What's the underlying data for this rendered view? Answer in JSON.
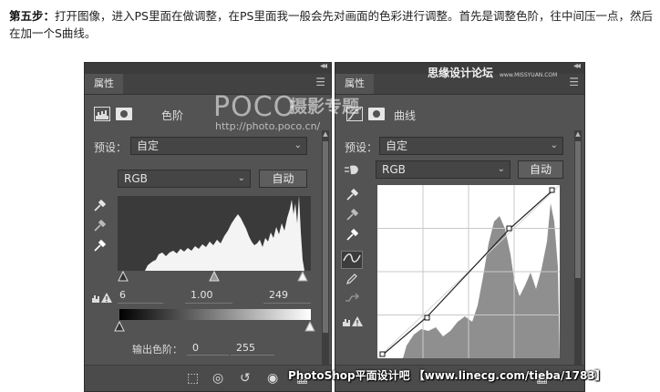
{
  "intro": {
    "step": "第五步：",
    "text": "打开图像，进入PS里面在做调整，在PS里面我一般会先对画面的色彩进行调整。首先是调整色阶，往中间压一点，然后在加一个S曲线。"
  },
  "levels_panel": {
    "tab": "属性",
    "title": "色阶",
    "preset_label": "预设：",
    "preset_value": "自定",
    "channel": "RGB",
    "auto_label": "自动",
    "input_black": "6",
    "input_gamma": "1.00",
    "input_white": "249",
    "output_label": "输出色阶：",
    "output_black": "0",
    "output_white": "255",
    "icons": [
      "black-eyedropper-icon",
      "gray-eyedropper-icon",
      "white-eyedropper-icon",
      "warning-icon",
      "clip-to-layer-icon",
      "visibility-icon",
      "reset-icon",
      "eye-icon"
    ]
  },
  "curves_panel": {
    "tab": "属性",
    "title": "曲线",
    "preset_label": "预设：",
    "preset_value": "自定",
    "channel": "RGB",
    "auto_label": "自动",
    "icons": [
      "hand-adjust-icon",
      "black-eyedropper-icon",
      "gray-eyedropper-icon",
      "white-eyedropper-icon",
      "curve-point-icon",
      "pencil-icon",
      "smooth-icon",
      "warning-icon"
    ]
  },
  "watermarks": {
    "poco_logo": "POCO",
    "poco_cn": "摄影专题",
    "poco_url": "http://photo.poco.cn/",
    "site_cn": "思缘设计论坛",
    "site_url": "www.MISSYUAN.COM",
    "bottom": "PhotoShop平面设计吧 【www.linecg.com/tieba/1783】"
  }
}
